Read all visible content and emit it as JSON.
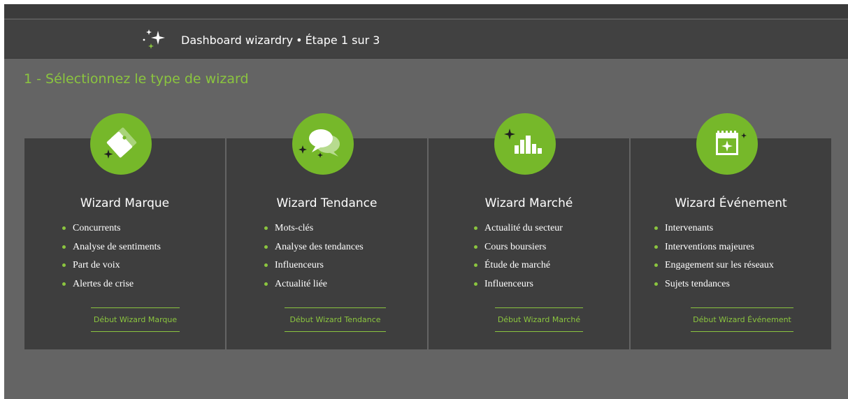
{
  "header": {
    "title": "Dashboard wizardry",
    "separator": "•",
    "step": "Étape 1 sur 3"
  },
  "main": {
    "heading": "1 - Sélectionnez le type de wizard"
  },
  "colors": {
    "accent": "#8bc53f",
    "icon_bg": "#76b82a",
    "card_bg": "#3e3e3e",
    "page_bg": "#646464",
    "header_bg": "#414141"
  },
  "wizards": [
    {
      "icon": "tag-icon",
      "title": "Wizard Marque",
      "items": [
        "Concurrents",
        "Analyse de sentiments",
        "Part de voix",
        "Alertes de crise"
      ],
      "button": "Début Wizard Marque"
    },
    {
      "icon": "chat-bubbles-icon",
      "title": "Wizard Tendance",
      "items": [
        "Mots-clés",
        "Analyse des tendances",
        "Influenceurs",
        "Actualité liée"
      ],
      "button": "Début Wizard Tendance"
    },
    {
      "icon": "bar-chart-icon",
      "title": "Wizard Marché",
      "items": [
        "Actualité du secteur",
        "Cours boursiers",
        "Étude de marché",
        "Influenceurs"
      ],
      "button": "Début Wizard Marché"
    },
    {
      "icon": "calendar-icon",
      "title": "Wizard Événement",
      "items": [
        "Intervenants",
        "Interventions majeures",
        "Engagement sur les réseaux",
        "Sujets tendances"
      ],
      "button": "Début Wizard Événement"
    }
  ]
}
